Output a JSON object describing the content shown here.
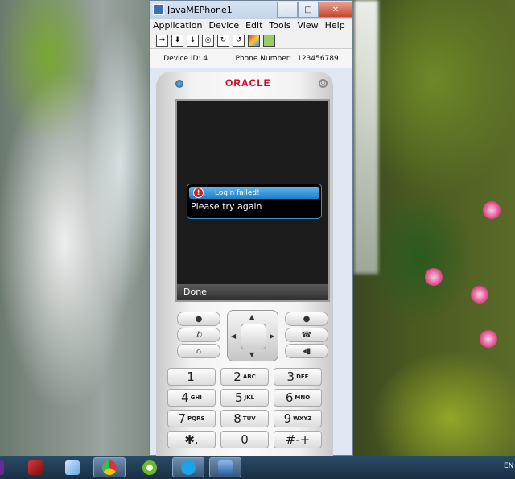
{
  "window": {
    "title": "JavaMEPhone1",
    "controls": {
      "minimize": "–",
      "maximize": "□",
      "close": "✕"
    },
    "menu": [
      "Application",
      "Device",
      "Edit",
      "Tools",
      "View",
      "Help"
    ],
    "toolbar_icons": [
      "run-icon",
      "install-icon",
      "import-icon",
      "settings-icon",
      "refresh-icon",
      "resume-icon",
      "color-icon",
      "monitor-icon"
    ]
  },
  "device_info": {
    "device_id_label": "Device ID: 4",
    "phone_number_label": "Phone Number:",
    "phone_number": "123456789"
  },
  "phone": {
    "brand": "ORACLE",
    "dialog": {
      "title": "Login failed!",
      "message": "Please try again"
    },
    "soft_key_label": "Done",
    "keys": [
      {
        "num": "1",
        "letters": ""
      },
      {
        "num": "2",
        "letters": "ABC"
      },
      {
        "num": "3",
        "letters": "DEF"
      },
      {
        "num": "4",
        "letters": "GHI"
      },
      {
        "num": "5",
        "letters": "JKL"
      },
      {
        "num": "6",
        "letters": "MNO"
      },
      {
        "num": "7",
        "letters": "PQRS"
      },
      {
        "num": "8",
        "letters": "TUV"
      },
      {
        "num": "9",
        "letters": "WXYZ"
      },
      {
        "num": "✱.",
        "letters": ""
      },
      {
        "num": "0",
        "letters": ""
      },
      {
        "num": "#-+",
        "letters": ""
      }
    ]
  },
  "taskbar": {
    "language": "EN",
    "apps": [
      "app-icon",
      "filezilla-icon",
      "virtualbox-icon",
      "chrome-icon",
      "netbeans-icon",
      "skype-icon",
      "emulator-icon"
    ]
  },
  "colors": {
    "brand_red": "#d0021b",
    "dialog_blue": "#1e7fc6",
    "taskbar": "#1a2f44"
  }
}
